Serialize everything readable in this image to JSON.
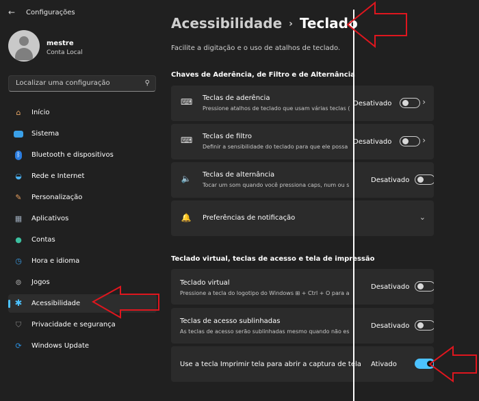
{
  "app": {
    "title": "Configurações"
  },
  "user": {
    "name": "mestre",
    "account_type": "Conta Local"
  },
  "search": {
    "placeholder": "Localizar uma configuração"
  },
  "sidebar": {
    "items": [
      {
        "label": "Início",
        "icon": "home-icon",
        "color": "#e8a665"
      },
      {
        "label": "Sistema",
        "icon": "system-icon",
        "color": "#3aa0e8"
      },
      {
        "label": "Bluetooth e dispositivos",
        "icon": "bluetooth-icon",
        "color": "#2b7de0"
      },
      {
        "label": "Rede e Internet",
        "icon": "wifi-icon",
        "color": "#4ab0f0"
      },
      {
        "label": "Personalização",
        "icon": "brush-icon",
        "color": "#e8a060"
      },
      {
        "label": "Aplicativos",
        "icon": "apps-icon",
        "color": "#9aa8b8"
      },
      {
        "label": "Contas",
        "icon": "accounts-icon",
        "color": "#3cc0a0"
      },
      {
        "label": "Hora e idioma",
        "icon": "clock-globe-icon",
        "color": "#3a9ee8"
      },
      {
        "label": "Jogos",
        "icon": "gamepad-icon",
        "color": "#b0b0b0"
      },
      {
        "label": "Acessibilidade",
        "icon": "accessibility-icon",
        "color": "#4cc2ff",
        "selected": true
      },
      {
        "label": "Privacidade e segurança",
        "icon": "shield-icon",
        "color": "#8a8a8a"
      },
      {
        "label": "Windows Update",
        "icon": "update-icon",
        "color": "#2b90e0"
      }
    ]
  },
  "header": {
    "parent": "Acessibilidade",
    "current": "Teclado",
    "subtitle": "Facilite a digitação e o uso de atalhos de teclado."
  },
  "sections": {
    "sticky_heading": "Chaves de Aderência, de Filtro e de Alternância",
    "virtual_heading": "Teclado virtual, teclas de acesso e tela de impressão"
  },
  "settings": {
    "sticky": {
      "title": "Teclas de aderência",
      "desc": "Pressione atalhos de teclado que usam várias teclas (",
      "state": "Desativado"
    },
    "filter": {
      "title": "Teclas de filtro",
      "desc": "Definir a sensibilidade do teclado para que ele possa",
      "state": "Desativado"
    },
    "toggle_keys": {
      "title": "Teclas de alternância",
      "desc": "Tocar um som quando você pressiona caps, num ou s",
      "state": "Desativado"
    },
    "notifications": {
      "title": "Preferências de notificação"
    },
    "virtual_kb": {
      "title": "Teclado virtual",
      "desc": "Pressione a tecla do logotipo do Windows ⊞ + Ctrl + O para a",
      "state": "Desativado"
    },
    "access_keys": {
      "title": "Teclas de acesso sublinhadas",
      "desc": "As teclas de acesso serão sublinhadas mesmo quando não es",
      "state": "Desativado"
    },
    "print_screen": {
      "title": "Use a tecla Imprimir tela para abrir a captura de tela",
      "state": "Ativado"
    }
  },
  "accent": "#4cc2ff",
  "annotation_color": "#e0161e"
}
